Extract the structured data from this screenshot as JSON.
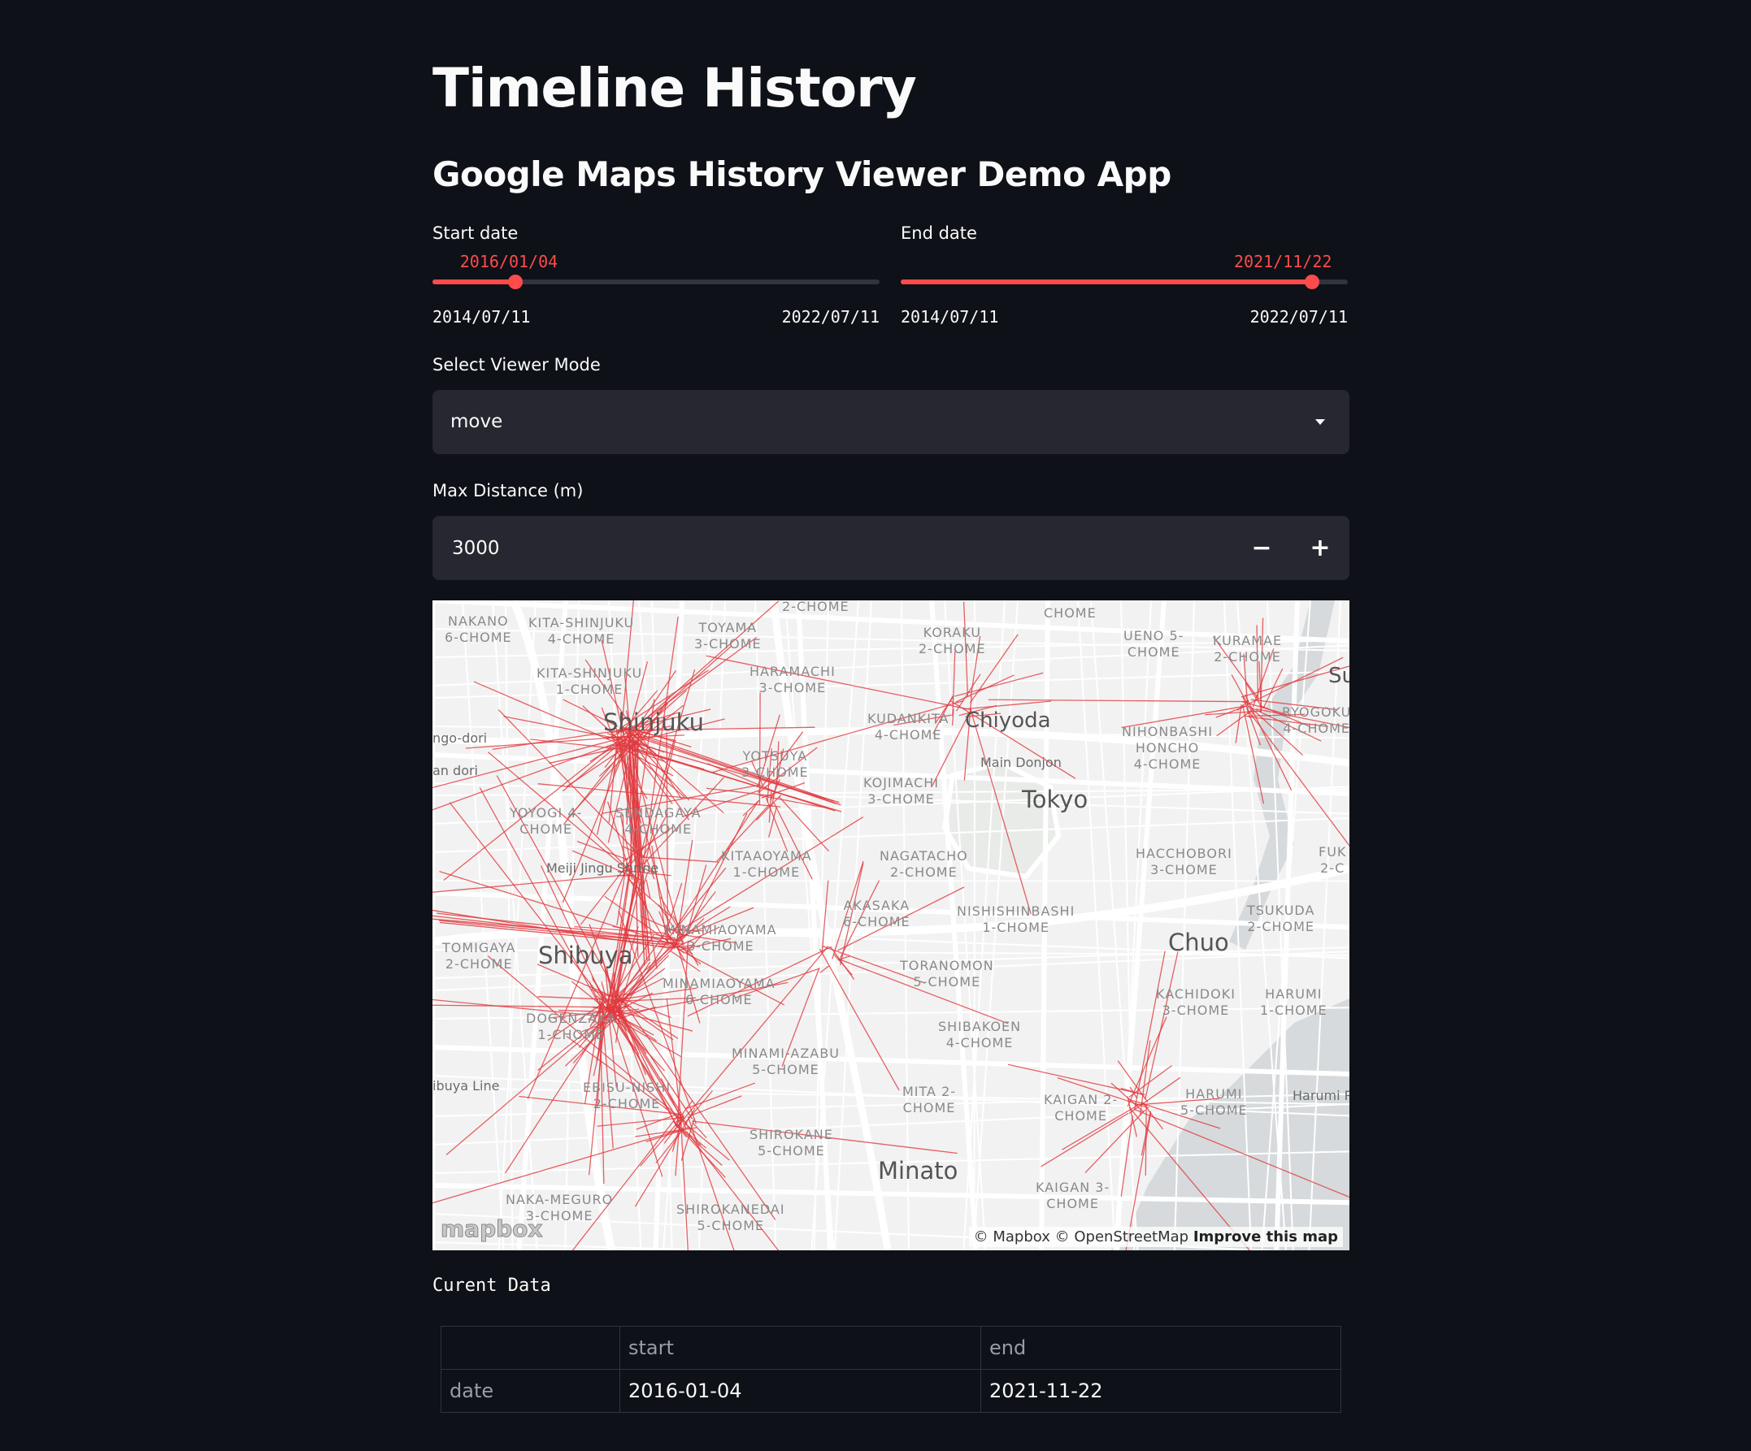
{
  "page": {
    "title": "Timeline History",
    "subtitle": "Google Maps History Viewer Demo App"
  },
  "start_slider": {
    "label": "Start date",
    "value": "2016/01/04",
    "min": "2014/07/11",
    "max": "2022/07/11",
    "fraction": 0.185
  },
  "end_slider": {
    "label": "End date",
    "value": "2021/11/22",
    "min": "2014/07/11",
    "max": "2022/07/11",
    "fraction": 0.92
  },
  "viewer_mode": {
    "label": "Select Viewer Mode",
    "value": "move"
  },
  "max_distance": {
    "label": "Max Distance (m)",
    "value": "3000",
    "minus": "−",
    "plus": "+"
  },
  "map": {
    "labels": {
      "shinjuku": "Shinjuku",
      "chiyoda": "Chiyoda",
      "tokyo": "Tokyo",
      "shibuya": "Shibuya",
      "chuo": "Chuo",
      "minato": "Minato",
      "main_donjon": "Main Donjon",
      "meiji": "Meiji Jingu Shrine",
      "nakano": "NAKANO\n6-CHOME",
      "kita_shinjuku_4": "KITA-SHINJUKU\n4-CHOME",
      "kita_shinjuku_1": "KITA-SHINJUKU\n1-CHOME",
      "toyama": "TOYAMA\n3-CHOME",
      "haramachi": "HARAMACHI\n3-CHOME",
      "koraku": "KORAKU\n2-CHOME",
      "ueno": "UENO 5-\nCHOME",
      "kuramae": "KURAMAE\n2-CHOME",
      "kudankita": "KUDANKITA\n4-CHOME",
      "nihonbashi": "NIHONBASHI\nHONCHO\n4-CHOME",
      "ryogoku": "RYOGOKU\n4-CHOME",
      "yotsuya": "YOTSUYA\n3-CHOME",
      "kojimachi": "KOJIMACHI\n3-CHOME",
      "yoyogi": "YOYOGI 4-\nCHOME",
      "sendagaya": "SENDAGAYA\n4-CHOME",
      "kitaaoyama": "KITAAOYAMA\n1-CHOME",
      "nagatacho": "NAGATACHO\n2-CHOME",
      "hacchobori": "HACCHOBORI\n3-CHOME",
      "akasaka": "AKASAKA\n6-CHOME",
      "nishishinbashi": "NISHISHINBASHI\n1-CHOME",
      "tomigaya": "TOMIGAYA\n2-CHOME",
      "minamiaoyama_3": "MINAMIAOYAMA\n3-CHOME",
      "minamiaoyama_6": "MINAMIAOYAMA\n6-CHOME",
      "toranomon": "TORANOMON\n5-CHOME",
      "tsukuda": "TSUKUDA\n2-CHOME",
      "kachidoki": "KACHIDOKI\n3-CHOME",
      "harumi_1": "HARUMI\n1-CHOME",
      "dogenzaka": "DOGENZAKA\n1-CHOME",
      "shibakoen": "SHIBAKOEN\n4-CHOME",
      "minami_azabu": "MINAMI-AZABU\n5-CHOME",
      "ebisu": "EBISU-NISHI\n2-CHOME",
      "mita": "MITA 2-\nCHOME",
      "kaigan_2": "KAIGAN 2-\nCHOME",
      "harumi_5": "HARUMI\n5-CHOME",
      "shirokane": "SHIROKANE\n5-CHOME",
      "kaigan_3": "KAIGAN 3-\nCHOME",
      "naka_meguro": "NAKA-MEGURO\n3-CHOME",
      "shirokanedai": "SHIROKANEDAI\n5-CHOME",
      "chome_top": "2-CHOME",
      "chome_top2": "CHOME",
      "su": "Su",
      "fuk": "FUK\n2-C",
      "ngo_dori": "ngo-dori",
      "an_dori": "an dori",
      "harumi_road": "Harumi Ro",
      "ibuya_line": "ibuya Line"
    },
    "logo": "mapbox",
    "attribution_mapbox": "© Mapbox",
    "attribution_osm": "© OpenStreetMap",
    "attribution_improve": "Improve this map",
    "colors": {
      "route": "#e0393e",
      "water": "#d6dadc",
      "road": "#ffffff",
      "park": "#e9ebe9"
    }
  },
  "current_data": {
    "heading": "Curent Data",
    "columns": [
      "",
      "start",
      "end"
    ],
    "rows": [
      {
        "label": "date",
        "start": "2016-01-04",
        "end": "2021-11-22"
      }
    ]
  }
}
